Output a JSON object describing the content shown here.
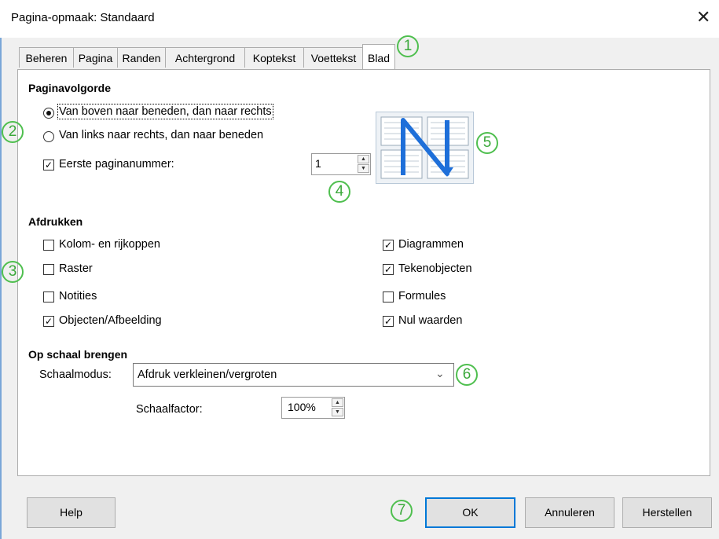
{
  "window": {
    "title": "Pagina-opmaak: Standaard",
    "close_glyph": "✕"
  },
  "tabs": [
    {
      "label": "Beheren"
    },
    {
      "label": "Pagina"
    },
    {
      "label": "Randen"
    },
    {
      "label": "Achtergrond"
    },
    {
      "label": "Koptekst"
    },
    {
      "label": "Voettekst"
    },
    {
      "label": "Blad",
      "active": true
    }
  ],
  "page_order": {
    "heading": "Paginavolgorde",
    "option_top_down": "Van boven naar beneden, dan naar rechts",
    "option_left_right": "Van links naar rechts, dan naar beneden",
    "selected": "top_down",
    "first_page_label": "Eerste paginanummer:",
    "first_page_checked": true,
    "first_page_value": "1",
    "preview_icon": "page-order-preview-icon"
  },
  "print": {
    "heading": "Afdrukken",
    "left": [
      {
        "label": "Kolom- en rijkoppen",
        "checked": false
      },
      {
        "label": "Raster",
        "checked": false
      },
      {
        "label": "Notities",
        "checked": false
      },
      {
        "label": "Objecten/Afbeelding",
        "checked": true
      }
    ],
    "right": [
      {
        "label": "Diagrammen",
        "checked": true
      },
      {
        "label": "Tekenobjecten",
        "checked": true
      },
      {
        "label": "Formules",
        "checked": false
      },
      {
        "label": "Nul waarden",
        "checked": true
      }
    ]
  },
  "scale": {
    "heading": "Op schaal brengen",
    "mode_label": "Schaalmodus:",
    "mode_value": "Afdruk verkleinen/vergroten",
    "factor_label": "Schaalfactor:",
    "factor_value": "100%"
  },
  "buttons": {
    "help": "Help",
    "ok": "OK",
    "cancel": "Annuleren",
    "reset": "Herstellen"
  },
  "annotations": [
    "1",
    "2",
    "3",
    "4",
    "5",
    "6",
    "7"
  ],
  "colors": {
    "annotation": "#4fbf4f",
    "preview_arrow": "#1e6fd9",
    "default_button_border": "#0078d7"
  }
}
